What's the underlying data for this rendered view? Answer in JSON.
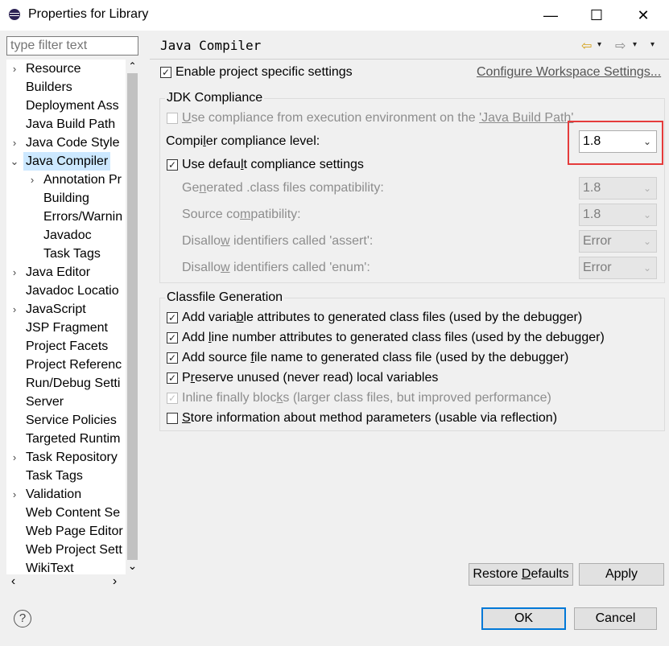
{
  "window": {
    "title": "Properties for Library",
    "minimize": "—",
    "maximize": "☐",
    "close": "✕"
  },
  "filter": {
    "placeholder": "type filter text"
  },
  "tree": [
    {
      "label": "Resource",
      "expander": "›",
      "level": 0
    },
    {
      "label": "Builders",
      "expander": "",
      "level": 0
    },
    {
      "label": "Deployment Ass",
      "expander": "",
      "level": 0
    },
    {
      "label": "Java Build Path",
      "expander": "",
      "level": 0
    },
    {
      "label": "Java Code Style",
      "expander": "›",
      "level": 0
    },
    {
      "label": "Java Compiler",
      "expander": "⌄",
      "level": 0,
      "selected": true
    },
    {
      "label": "Annotation Pr",
      "expander": "›",
      "level": 1
    },
    {
      "label": "Building",
      "expander": "",
      "level": 1
    },
    {
      "label": "Errors/Warnin",
      "expander": "",
      "level": 1
    },
    {
      "label": "Javadoc",
      "expander": "",
      "level": 1
    },
    {
      "label": "Task Tags",
      "expander": "",
      "level": 1
    },
    {
      "label": "Java Editor",
      "expander": "›",
      "level": 0
    },
    {
      "label": "Javadoc Locatio",
      "expander": "",
      "level": 0
    },
    {
      "label": "JavaScript",
      "expander": "›",
      "level": 0
    },
    {
      "label": "JSP Fragment",
      "expander": "",
      "level": 0
    },
    {
      "label": "Project Facets",
      "expander": "",
      "level": 0
    },
    {
      "label": "Project Referenc",
      "expander": "",
      "level": 0
    },
    {
      "label": "Run/Debug Setti",
      "expander": "",
      "level": 0
    },
    {
      "label": "Server",
      "expander": "",
      "level": 0
    },
    {
      "label": "Service Policies",
      "expander": "",
      "level": 0
    },
    {
      "label": "Targeted Runtim",
      "expander": "",
      "level": 0
    },
    {
      "label": "Task Repository",
      "expander": "›",
      "level": 0
    },
    {
      "label": "Task Tags",
      "expander": "",
      "level": 0
    },
    {
      "label": "Validation",
      "expander": "›",
      "level": 0
    },
    {
      "label": "Web Content Se",
      "expander": "",
      "level": 0
    },
    {
      "label": "Web Page Editor",
      "expander": "",
      "level": 0
    },
    {
      "label": "Web Project Sett",
      "expander": "",
      "level": 0
    },
    {
      "label": "WikiText",
      "expander": "",
      "level": 0
    }
  ],
  "scroll": {
    "up": "⌃",
    "down": "⌄",
    "left": "‹",
    "right": "›"
  },
  "page": {
    "title": "Java Compiler",
    "nav_back": "⇦",
    "nav_forward": "⇨",
    "nav_menu": "▾",
    "enable_specific": {
      "pre": "Enable pro",
      "u": "j",
      "post": "ect specific settings"
    },
    "configure_link": "Configure Workspace Settings..."
  },
  "jdk": {
    "group_title": "JDK Compliance",
    "use_env": {
      "pre": "",
      "u": "U",
      "post": "se compliance from execution environment on the "
    },
    "use_env_link": "'Java Build Path'",
    "compliance_label": {
      "pre": "Compi",
      "u": "l",
      "post": "er compliance level:"
    },
    "compliance_value": "1.8",
    "use_default": {
      "pre": "Use defau",
      "u": "l",
      "post": "t compliance settings"
    },
    "generated": {
      "label_pre": "Ge",
      "label_u": "n",
      "label_post": "erated .class files compatibility:",
      "value": "1.8"
    },
    "source": {
      "label_pre": "Source co",
      "label_u": "m",
      "label_post": "patibility:",
      "value": "1.8"
    },
    "assert": {
      "label_pre": "Disallo",
      "label_u": "w",
      "label_post": " identifiers called 'assert':",
      "value": "Error"
    },
    "enum": {
      "label_pre": "Disallo",
      "label_u": "w",
      "label_post": " identifiers called 'enum':",
      "value": "Error"
    }
  },
  "classfile": {
    "group_title": "Classfile Generation",
    "items": [
      {
        "pre": "Add varia",
        "u": "b",
        "post": "le attributes to generated class files (used by the debugger)",
        "checked": true,
        "disabled": false
      },
      {
        "pre": "Add ",
        "u": "l",
        "post": "ine number attributes to generated class files (used by the debugger)",
        "checked": true,
        "disabled": false
      },
      {
        "pre": "Add source ",
        "u": "f",
        "post": "ile name to generated class file (used by the debugger)",
        "checked": true,
        "disabled": false
      },
      {
        "pre": "P",
        "u": "r",
        "post": "eserve unused (never read) local variables",
        "checked": true,
        "disabled": false
      },
      {
        "pre": "Inline finally bloc",
        "u": "k",
        "post": "s (larger class files, but improved performance)",
        "checked": true,
        "disabled": true
      },
      {
        "pre": "",
        "u": "S",
        "post": "tore information about method parameters (usable via reflection)",
        "checked": false,
        "disabled": false
      }
    ]
  },
  "buttons": {
    "restore_pre": "Restore ",
    "restore_u": "D",
    "restore_post": "efaults",
    "apply": "Apply",
    "ok": "OK",
    "cancel": "Cancel",
    "help": "?"
  },
  "check_glyph": "✓",
  "combo_arrow": "⌄",
  "colors": {
    "highlight": "#e53b3b",
    "selection": "#cce8ff",
    "default_button": "#0078d7"
  }
}
